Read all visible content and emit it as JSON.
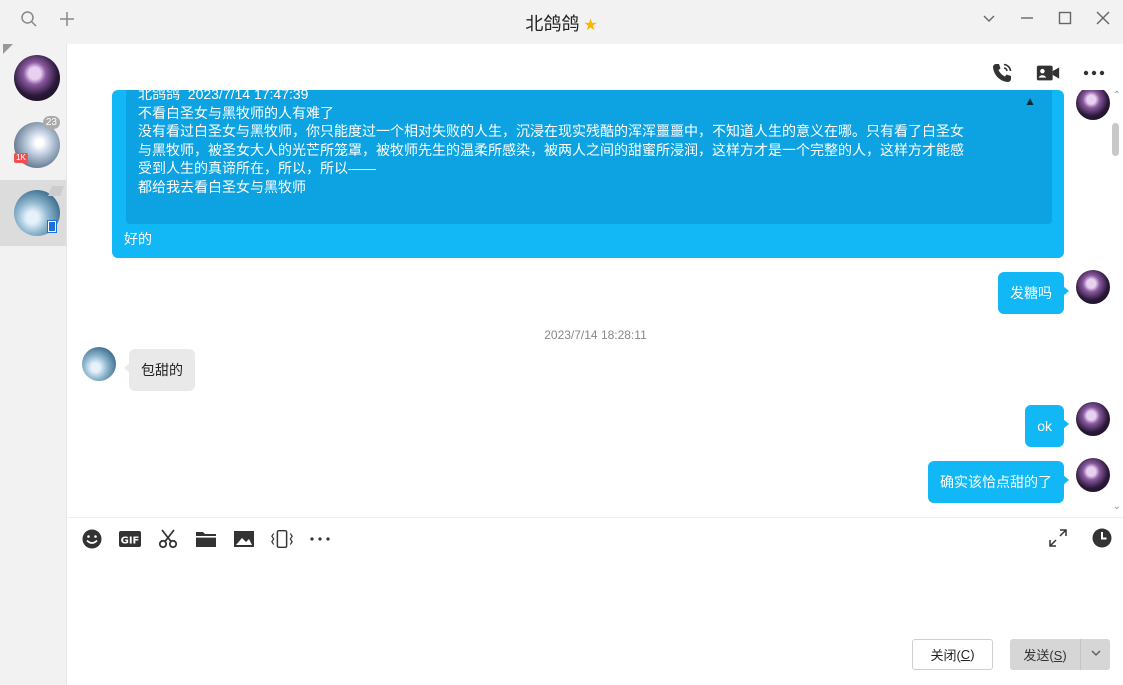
{
  "window": {
    "title": "北鸽鸽",
    "star_icon": "star-icon",
    "left_icons": [
      "search-icon",
      "plus-icon"
    ],
    "right_icons": [
      "chevron-down-icon",
      "minimize-icon",
      "maximize-icon",
      "close-icon"
    ]
  },
  "sidebar": {
    "items": [
      {
        "avatar": "avatar-purple",
        "active": false
      },
      {
        "avatar": "avatar-silver",
        "badge": "23",
        "tag": "1K",
        "active": false
      },
      {
        "avatar": "avatar-blue",
        "active": true
      }
    ]
  },
  "chat_header": {
    "icons": [
      "voice-call-icon",
      "video-call-icon",
      "more-icon"
    ]
  },
  "messages": {
    "quoted": {
      "author": "北鸽鸽",
      "time": "2023/7/14 17:47:39",
      "line1": "不看白圣女与黑牧师的人有难了",
      "line2": "没有看过白圣女与黑牧师，你只能度过一个相对失败的人生，沉浸在现实残酷的浑浑噩噩中，不知道人生的意义在哪。只有看了白圣女",
      "line3": "与黑牧师，被圣女大人的光芒所笼罩，被牧师先生的温柔所感染，被两人之间的甜蜜所浸润，这样方才是一个完整的人，这样方才能感",
      "line4": "受到人生的真谛所在，所以，所以——",
      "line5": "都给我去看白圣女与黑牧师"
    },
    "reply": "好的",
    "m1": "发糖吗",
    "timestamp": "2023/7/14 18:28:11",
    "m2": "包甜的",
    "m3": "ok",
    "m4": "确实该恰点甜的了"
  },
  "toolbar": {
    "icons": [
      "emoji-icon",
      "gif-icon",
      "scissors-icon",
      "folder-icon",
      "image-icon",
      "shake-icon",
      "more-icon"
    ],
    "right_icons": [
      "expand-icon",
      "history-icon"
    ]
  },
  "buttons": {
    "close_label": "关闭(",
    "close_key": "C",
    "close_end": ")",
    "send_label": "发送(",
    "send_key": "S",
    "send_end": ")"
  },
  "colors": {
    "accent": "#12b7f5",
    "quote_bg": "#0da3e2",
    "incoming_bg": "#e9e9e9",
    "star": "#f5b800"
  }
}
